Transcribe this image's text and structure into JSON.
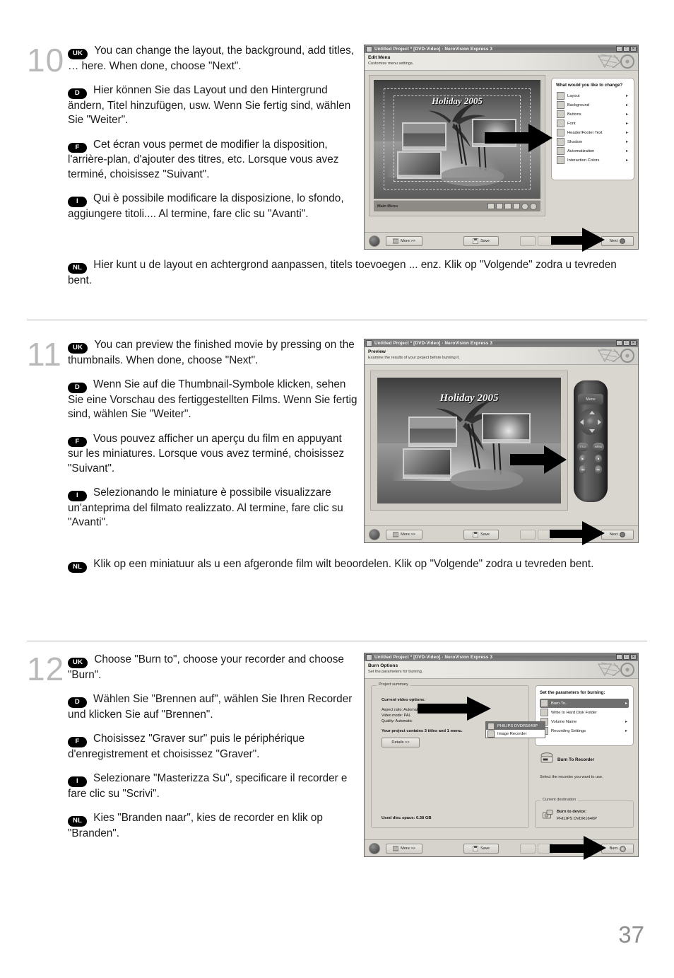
{
  "page": {
    "number": "37"
  },
  "steps": [
    {
      "number": "10",
      "paragraphs": [
        {
          "flag": "UK",
          "text": "You can change the layout, the background, add titles, … here. When done, choose \"Next\"."
        },
        {
          "flag": "D",
          "text": "Hier können Sie das Layout und den Hintergrund ändern, Titel hinzufügen, usw. Wenn Sie fertig sind, wählen Sie \"Weiter\"."
        },
        {
          "flag": "F",
          "text": "Cet écran vous permet de modifier la disposition, l'arrière-plan, d'ajouter des titres, etc. Lorsque vous avez terminé, choisissez \"Suivant\"."
        },
        {
          "flag": "I",
          "text": "Qui è possibile modificare la disposizione, lo sfondo, aggiungere titoli.... Al termine, fare clic su \"Avanti\"."
        }
      ],
      "wide_paragraph": {
        "flag": "NL",
        "text": "Hier kunt u de layout en achtergrond aanpassen, titels toevoegen ... enz. Klik op \"Volgende\" zodra u tevreden bent."
      }
    },
    {
      "number": "11",
      "paragraphs": [
        {
          "flag": "UK",
          "text": "You can preview the finished movie by pressing on the thumbnails. When done, choose \"Next\"."
        },
        {
          "flag": "D",
          "text": "Wenn Sie auf die Thumbnail-Symbole klicken, sehen Sie eine Vorschau des fertiggestellten Films. Wenn Sie fertig sind, wählen Sie \"Weiter\"."
        },
        {
          "flag": "F",
          "text": "Vous pouvez afficher un aperçu du film en appuyant sur les miniatures. Lorsque vous avez terminé, choisissez \"Suivant\"."
        },
        {
          "flag": "I",
          "text": "Selezionando le miniature è possibile visualizzare un'anteprima del filmato realizzato. Al termine, fare clic su \"Avanti\"."
        }
      ],
      "wide_paragraph": {
        "flag": "NL",
        "text": "Klik op een miniatuur als u een afgeronde film wilt beoordelen. Klik op \"Volgende\" zodra u tevreden bent."
      }
    },
    {
      "number": "12",
      "paragraphs": [
        {
          "flag": "UK",
          "text": "Choose \"Burn to\", choose your recorder and choose \"Burn\"."
        },
        {
          "flag": "D",
          "text": "Wählen Sie \"Brennen auf\", wählen Sie Ihren Recorder und klicken Sie auf \"Brennen\"."
        },
        {
          "flag": "F",
          "text": "Choisissez \"Graver sur\" puis le périphérique d'enregistrement et choisissez \"Graver\"."
        },
        {
          "flag": "I",
          "text": "Selezionare \"Masterizza Su\", specificare il recorder e fare clic su \"Scrivi\"."
        },
        {
          "flag": "NL",
          "text": "Kies \"Branden naar\", kies de recorder en klik op \"Branden\"."
        }
      ]
    }
  ],
  "screenshots": {
    "common": {
      "window_title": "Untitled Project * [DVD-Video] - NeroVision Express 3",
      "minimize_glyph": "_",
      "maximize_glyph": "□",
      "close_glyph": "✕",
      "more_button": "More >>",
      "save_button": "Save",
      "next_button": "Next",
      "burn_button": "Burn",
      "help_icon": "help-icon"
    },
    "edit_menu": {
      "header_title": "Edit Menu",
      "header_sub": "Customize menu settings.",
      "menu_title_text": "Holiday 2005",
      "menu_bar_label": "Main Menu",
      "panel_title": "What would you like to change?",
      "panel_items": [
        {
          "label": "Layout",
          "icon": "layout-icon",
          "arrow": "▸"
        },
        {
          "label": "Background",
          "icon": "background-icon",
          "arrow": "▸"
        },
        {
          "label": "Buttons",
          "icon": "buttons-icon",
          "arrow": "▸"
        },
        {
          "label": "Font",
          "icon": "font-icon",
          "arrow": "▸"
        },
        {
          "label": "Header/Footer Text",
          "icon": "header-footer-icon",
          "arrow": "▸"
        },
        {
          "label": "Shadow",
          "icon": "shadow-icon",
          "arrow": "▸"
        },
        {
          "label": "Automatization",
          "icon": "automatization-icon",
          "arrow": "▸"
        },
        {
          "label": "Interaction Colors",
          "icon": "interaction-colors-icon",
          "arrow": "▸"
        }
      ]
    },
    "preview": {
      "header_title": "Preview",
      "header_sub": "Examine the results of your project before burning it.",
      "menu_title_text": "Holiday 2005",
      "remote": {
        "menu_label": "Menu",
        "title_button": "TITLE",
        "menu_button": "MENU",
        "play_button": "▶",
        "stop_button": "■",
        "prev_button": "◀◀",
        "next_button": "▶▶"
      }
    },
    "burn_options": {
      "header_title": "Burn Options",
      "header_sub": "Set the parameters for burning.",
      "summary_legend": "Project summary",
      "summary_heading": "Current video options:",
      "summary_lines": [
        "Aspect ratio: Automatic",
        "Video mode: PAL",
        "Quality: Automatic"
      ],
      "summary_contains": "Your project contains 3 titles and 1 menu.",
      "details_button": "Details >>",
      "used_disc_space": "Used disc space: 0.38 GB",
      "panel_title": "Set the parameters for burning:",
      "panel_items": [
        {
          "label": "Burn To..",
          "icon": "burn-to-icon",
          "arrow": "▸",
          "selected": true
        },
        {
          "label": "Write to Hard Disk Folder",
          "icon": "hard-disk-icon",
          "arrow": "",
          "selected": false
        },
        {
          "label": "Volume Name",
          "icon": "volume-name-icon",
          "arrow": "▸",
          "selected": false
        },
        {
          "label": "Recording Settings",
          "icon": "recording-settings-icon",
          "arrow": "▸",
          "selected": false
        }
      ],
      "dropdown_options": [
        {
          "label": "PHILIPS  DVDR1640P",
          "icon": "recorder-icon",
          "selected": true
        },
        {
          "label": "Image Recorder",
          "icon": "image-recorder-icon",
          "selected": false
        }
      ],
      "burn_to_recorder_title": "Burn To Recorder",
      "burn_to_recorder_sub": "Select the recorder you want to use.",
      "destination_legend": "Current destination",
      "destination_heading": "Burn to device:",
      "destination_device": "PHILIPS  DVDR1640P"
    }
  },
  "colors": {
    "flag_bg": "#000000",
    "step_number": "#b9b9b9",
    "divider": "#b0b0b0",
    "page_number": "#8d8d8d",
    "selection": "#6f6f6f"
  }
}
